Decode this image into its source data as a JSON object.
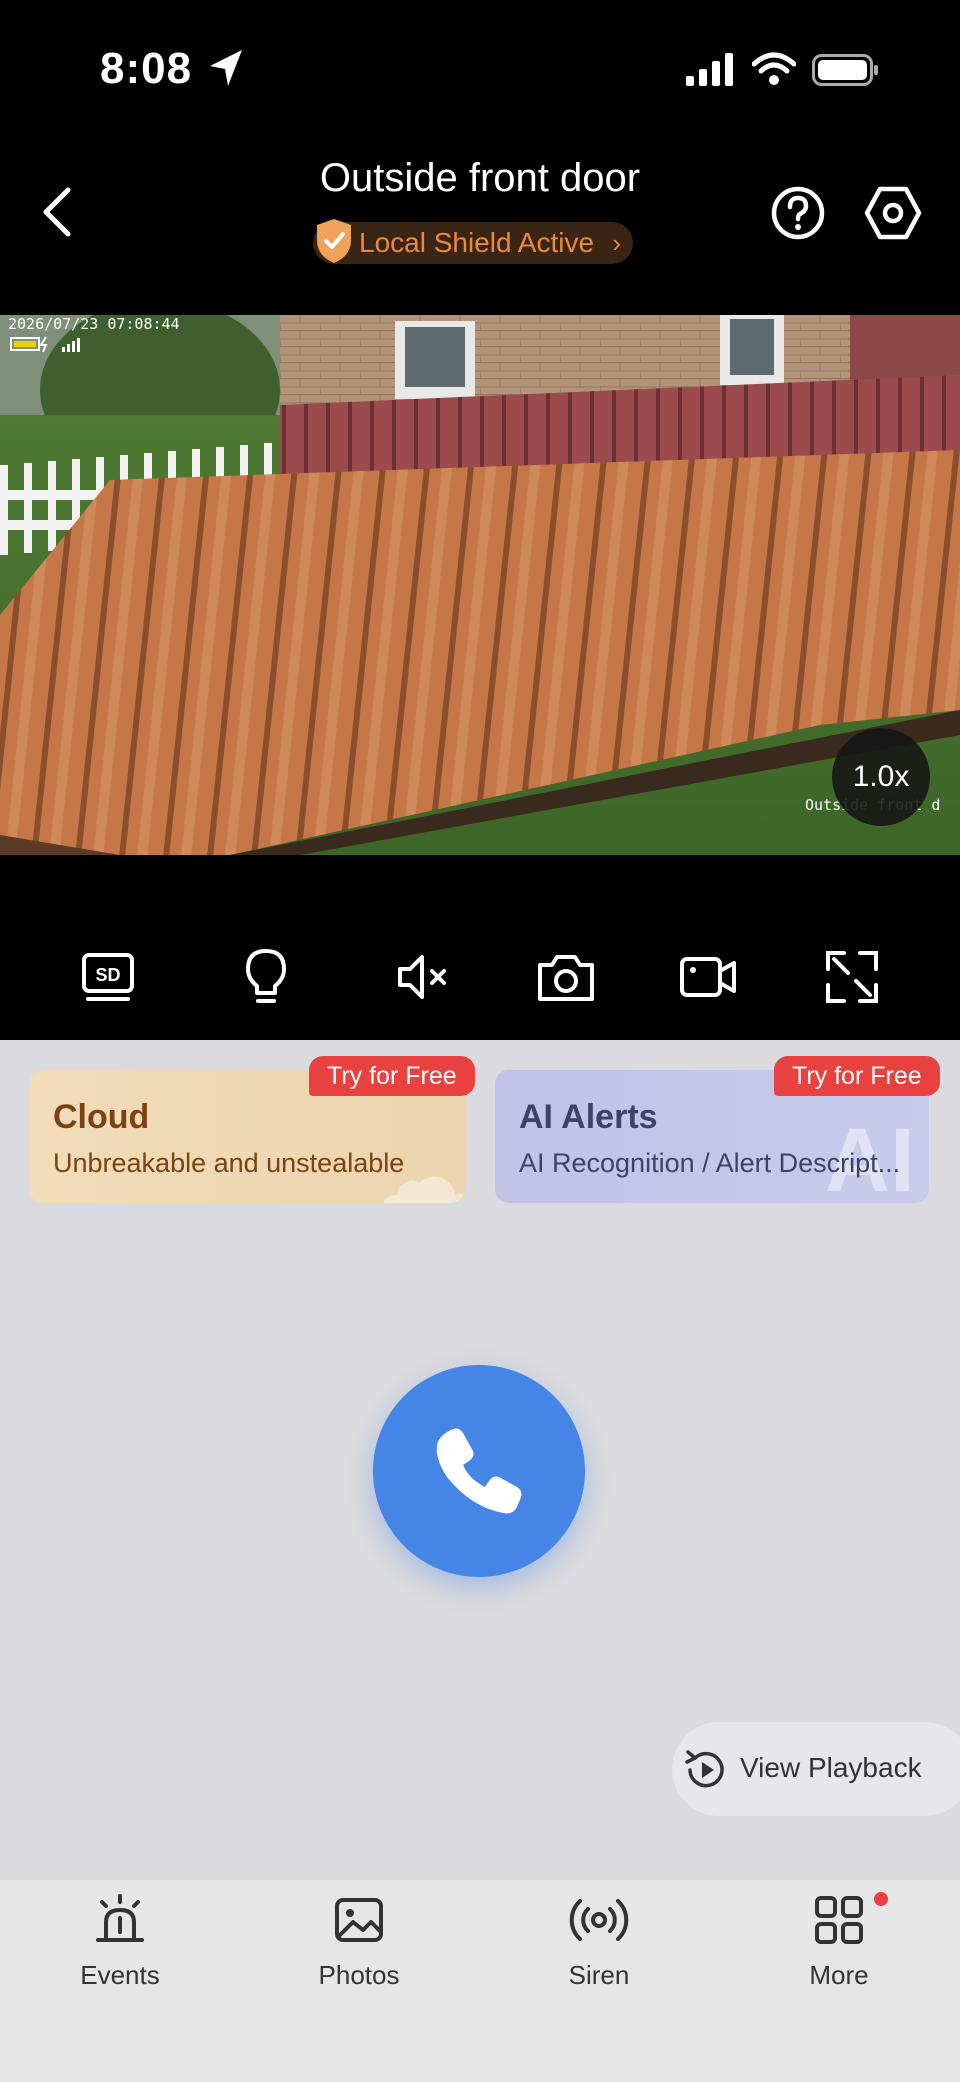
{
  "status_bar": {
    "time": "8:08",
    "icons": [
      "location-arrow-icon",
      "signal-icon",
      "wifi-icon",
      "battery-icon"
    ]
  },
  "header": {
    "title": "Outside front door",
    "shield_label": "Local Shield Active",
    "back_icon": "chevron-left-icon",
    "help_icon": "question-circle-icon",
    "settings_icon": "hexagon-settings-icon"
  },
  "camera": {
    "timestamp": "2026/07/23 07:08:44",
    "overlay_name": "Outside front d",
    "zoom": "1.0x"
  },
  "controls": [
    {
      "name": "sd-quality-button",
      "icon": "sd-icon"
    },
    {
      "name": "light-button",
      "icon": "bulb-icon"
    },
    {
      "name": "mute-button",
      "icon": "speaker-muted-icon"
    },
    {
      "name": "snapshot-button",
      "icon": "camera-icon"
    },
    {
      "name": "record-button",
      "icon": "video-icon"
    },
    {
      "name": "fullscreen-button",
      "icon": "expand-icon"
    }
  ],
  "promos": {
    "cloud": {
      "badge": "Try for Free",
      "title": "Cloud",
      "subtitle": "Unbreakable and unstealable"
    },
    "ai": {
      "badge": "Try for Free",
      "title": "AI Alerts",
      "subtitle": "AI Recognition / Alert Descript...",
      "ghost": "AI"
    }
  },
  "call": {
    "icon": "phone-icon"
  },
  "playback": {
    "label": "View Playback",
    "icon": "replay-icon"
  },
  "bottom_nav": [
    {
      "label": "Events",
      "icon": "alarm-icon"
    },
    {
      "label": "Photos",
      "icon": "image-icon"
    },
    {
      "label": "Siren",
      "icon": "broadcast-icon"
    },
    {
      "label": "More",
      "icon": "grid-icon"
    }
  ],
  "colors": {
    "accent_blue": "#4485e6",
    "badge_red": "#e8413f",
    "shield_orange": "#e98a3c"
  }
}
